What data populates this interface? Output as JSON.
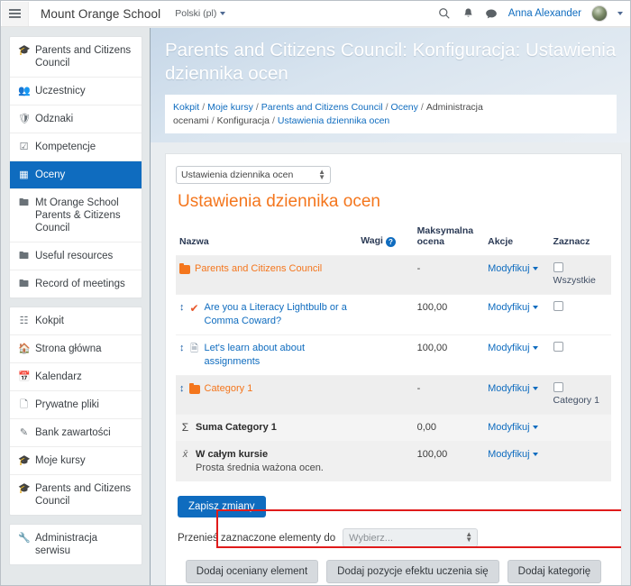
{
  "navbar": {
    "menu_icon": "hamburger-icon",
    "brand": "Mount Orange School",
    "language": "Polski (pl)",
    "search_icon": "search-icon",
    "notifications_icon": "bell-icon",
    "messages_icon": "message-icon",
    "username": "Anna Alexander",
    "avatar": "user-avatar"
  },
  "sidebar": {
    "groups": [
      {
        "items": [
          {
            "icon": "graduation-cap-icon",
            "label": "Parents and Citizens Council",
            "active": false
          },
          {
            "icon": "users-icon",
            "label": "Uczestnicy",
            "active": false
          },
          {
            "icon": "shield-icon",
            "label": "Odznaki",
            "active": false
          },
          {
            "icon": "check-square-icon",
            "label": "Kompetencje",
            "active": false
          },
          {
            "icon": "grid-icon",
            "label": "Oceny",
            "active": true
          },
          {
            "icon": "folder-icon",
            "label": "Mt Orange School Parents & Citizens Council",
            "active": false
          },
          {
            "icon": "folder-icon",
            "label": "Useful resources",
            "active": false
          },
          {
            "icon": "folder-icon",
            "label": "Record of meetings",
            "active": false
          }
        ]
      },
      {
        "items": [
          {
            "icon": "dashboard-icon",
            "label": "Kokpit",
            "active": false
          },
          {
            "icon": "home-icon",
            "label": "Strona główna",
            "active": false
          },
          {
            "icon": "calendar-icon",
            "label": "Kalendarz",
            "active": false
          },
          {
            "icon": "file-icon",
            "label": "Prywatne pliki",
            "active": false
          },
          {
            "icon": "brush-icon",
            "label": "Bank zawartości",
            "active": false
          },
          {
            "icon": "graduation-cap-icon",
            "label": "Moje kursy",
            "active": false
          },
          {
            "icon": "graduation-cap-icon",
            "label": "Parents and Citizens Council",
            "active": false
          }
        ]
      },
      {
        "items": [
          {
            "icon": "wrench-icon",
            "label": "Administracja serwisu",
            "active": false
          }
        ]
      }
    ]
  },
  "header": {
    "title": "Parents and Citizens Council: Konfiguracja: Ustawienia dziennika ocen"
  },
  "breadcrumb": {
    "items": [
      "Kokpit",
      "Moje kursy",
      "Parents and Citizens Council",
      "Oceny",
      "Administracja ocenami",
      "Konfiguracja",
      "Ustawienia dziennika ocen"
    ],
    "separator": "/"
  },
  "content": {
    "jump_select_value": "Ustawienia dziennika ocen",
    "section_title": "Ustawienia dziennika ocen",
    "table": {
      "headers": {
        "name": "Nazwa",
        "weights": "Wagi",
        "weights_help": "?",
        "max_grade": "Maksymalna ocena",
        "actions": "Akcje",
        "select": "Zaznacz"
      },
      "rows": [
        {
          "type": "category",
          "indent": 0,
          "move_handle": false,
          "icon": "folder-icon",
          "name": "Parents and Citizens Council",
          "weight": "",
          "max_grade": "-",
          "action": "Modyfikuj",
          "checkbox": true,
          "checkbox_label": "Wszystkie",
          "highlighted": false
        },
        {
          "type": "item",
          "indent": 1,
          "move_handle": true,
          "icon": "quiz-check-icon",
          "name": "Are you a Literacy Lightbulb or a Comma Coward?",
          "weight": "",
          "max_grade": "100,00",
          "action": "Modyfikuj",
          "checkbox": true,
          "checkbox_label": "",
          "highlighted": false
        },
        {
          "type": "item",
          "indent": 1,
          "move_handle": true,
          "icon": "assignment-icon",
          "name": "Let's learn about about assignments",
          "weight": "",
          "max_grade": "100,00",
          "action": "Modyfikuj",
          "checkbox": true,
          "checkbox_label": "",
          "highlighted": false
        },
        {
          "type": "category",
          "indent": 1,
          "move_handle": true,
          "icon": "folder-icon",
          "name": "Category 1",
          "weight": "",
          "max_grade": "-",
          "action": "Modyfikuj",
          "checkbox": true,
          "checkbox_label": "Category 1",
          "highlighted": true
        },
        {
          "type": "sum",
          "indent": 2,
          "move_handle": false,
          "icon": "sigma-icon",
          "name": "Suma Category 1",
          "weight": "",
          "max_grade": "0,00",
          "action": "Modyfikuj",
          "checkbox": false,
          "checkbox_label": "",
          "highlighted": false
        },
        {
          "type": "course",
          "indent": 0,
          "move_handle": false,
          "icon": "xbar-icon",
          "name": "W całym kursie",
          "subtitle": "Prosta średnia ważona ocen.",
          "weight": "",
          "max_grade": "100,00",
          "action": "Modyfikuj",
          "checkbox": false,
          "checkbox_label": "",
          "highlighted": false
        }
      ]
    },
    "save_button": "Zapisz zmiany",
    "move_label": "Przenieś zaznaczone elementy do",
    "move_select_value": "Wybierz...",
    "add_buttons": [
      "Dodaj oceniany element",
      "Dodaj pozycje efektu uczenia się",
      "Dodaj kategorię"
    ]
  },
  "colors": {
    "accent_blue": "#0f6cbf",
    "accent_orange": "#f4761d",
    "highlight_red": "#e01b1b",
    "sidebar_active_bg": "#0f6cbf"
  }
}
